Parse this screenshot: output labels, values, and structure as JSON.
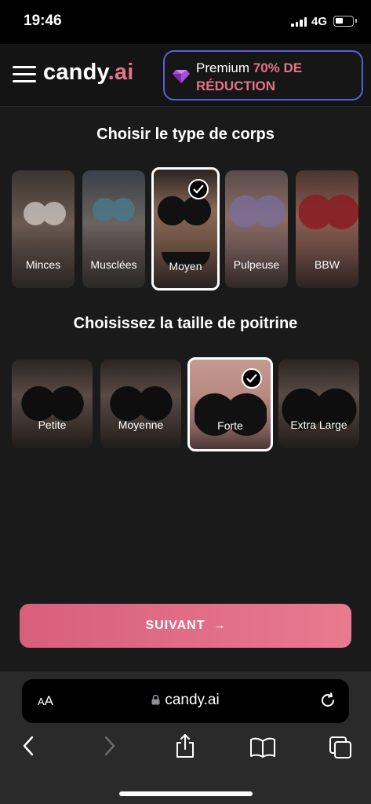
{
  "status": {
    "time": "19:46",
    "network": "4G"
  },
  "header": {
    "logo_main": "candy",
    "logo_accent": ".ai",
    "premium_prefix": "Premium",
    "premium_highlight": "70% DE",
    "premium_highlight2": "RÉDUCTION"
  },
  "body_type": {
    "title": "Choisir le type de corps",
    "selected": "Moyen",
    "options": [
      {
        "label": "Minces"
      },
      {
        "label": "Musclées"
      },
      {
        "label": "Moyen"
      },
      {
        "label": "Pulpeuse"
      },
      {
        "label": "BBW"
      }
    ]
  },
  "breast_size": {
    "title": "Choisissez la taille de poitrine",
    "selected": "Forte",
    "options": [
      {
        "label": "Petite"
      },
      {
        "label": "Moyenne"
      },
      {
        "label": "Forte"
      },
      {
        "label": "Extra Large"
      }
    ]
  },
  "continue_button": {
    "label": "SUIVANT",
    "arrow": "→"
  },
  "browser": {
    "text_size_small": "A",
    "text_size_large": "A",
    "url": "candy.ai"
  },
  "colors": {
    "accent": "#e57389",
    "premium_border": "#5a5fd6",
    "button_start": "#d85f7c",
    "button_end": "#e87a8f"
  }
}
